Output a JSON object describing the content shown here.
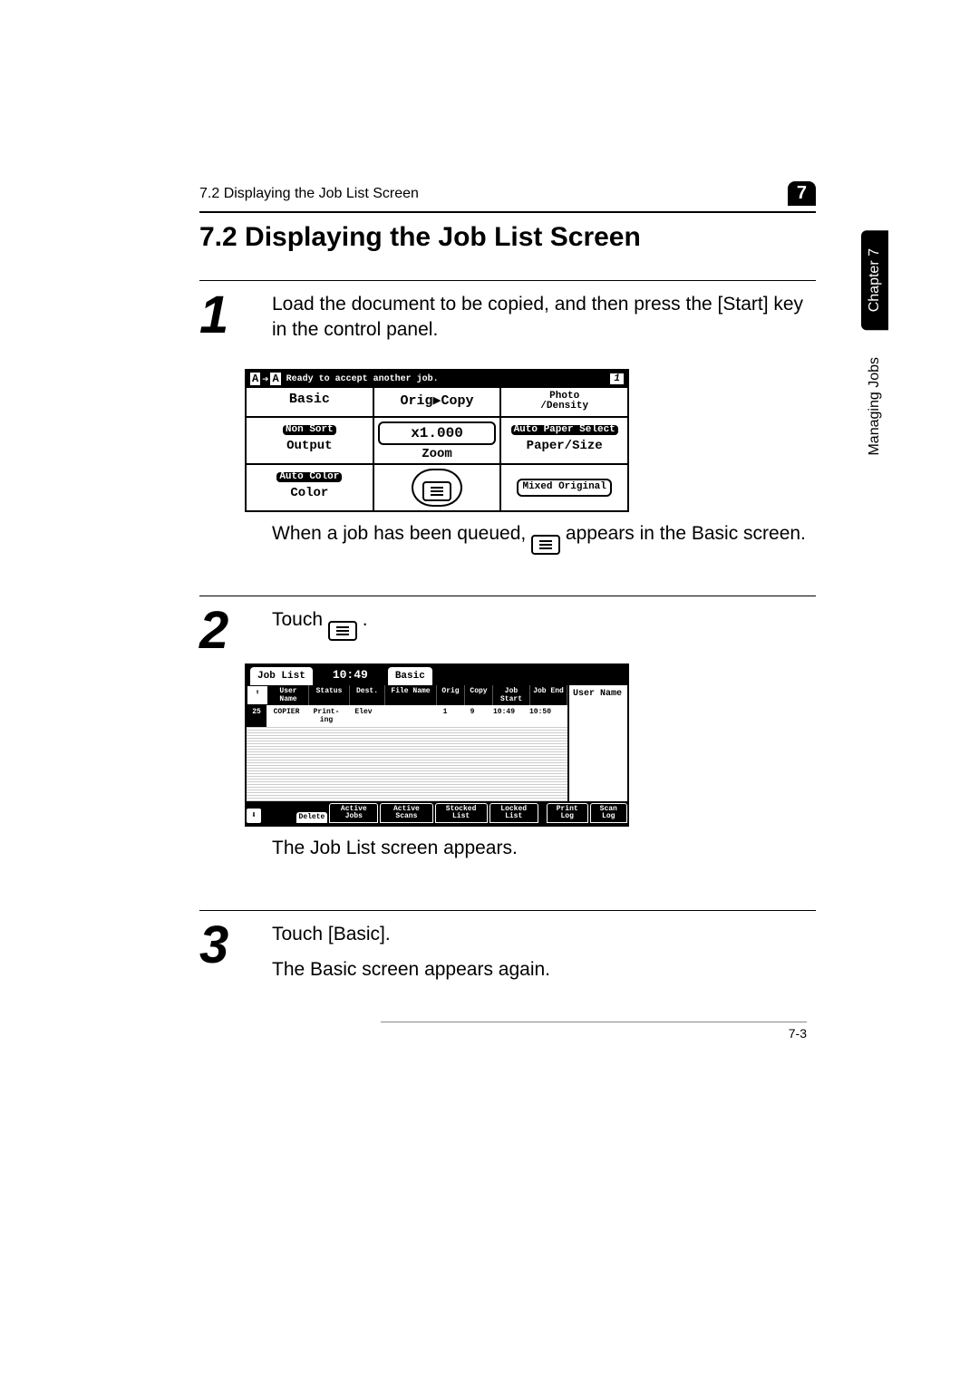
{
  "running_head": "7.2 Displaying the Job List Screen",
  "corner_tab": "7",
  "section_title": "7.2   Displaying the Job List Screen",
  "side": {
    "chapter": "Chapter 7",
    "section": "Managing Jobs"
  },
  "step1": {
    "num": "1",
    "text": "Load the document to be copied, and then press the [Start] key in the control panel.",
    "after1": "When a job has been queued, ",
    "after2": " appears in the Basic screen."
  },
  "screen1": {
    "status_msg": "Ready to accept another job.",
    "slot": "1",
    "tabs": {
      "basic": "Basic",
      "orig": "Orig▶Copy",
      "photo_l1": "Photo",
      "photo_l2": "/Density"
    },
    "row1": {
      "nonsort": "Non Sort",
      "output": "Output",
      "zoom_val": "x1.000",
      "zoom": "Zoom",
      "autopaper": "Auto Paper Select",
      "papersize": "Paper/Size"
    },
    "row2": {
      "autocolor": "Auto Color",
      "color": "Color",
      "mixed": "Mixed Original"
    }
  },
  "step2": {
    "num": "2",
    "text_before": "Touch ",
    "text_after": " .",
    "result": "The Job List screen appears."
  },
  "screen2": {
    "tab_joblist": "Job List",
    "time": "10:49",
    "tab_basic": "Basic",
    "headers": [
      "User Name",
      "Status",
      "Dest.",
      "File Name",
      "Orig",
      "Copy",
      "Job Start",
      "Job End"
    ],
    "right_header": "User Name",
    "row": {
      "num": "25",
      "user": "COPIER",
      "status": "Print- ing",
      "dest": "Elev",
      "file": "",
      "orig": "1",
      "copy": "9",
      "start": "10:49",
      "end": "10:50"
    },
    "bottom": {
      "delete": "Delete",
      "active_jobs": "Active Jobs",
      "active_scans": "Active Scans",
      "stocked": "Stocked List",
      "locked": "Locked List",
      "print_log": "Print Log",
      "scan_log": "Scan Log"
    }
  },
  "step3": {
    "num": "3",
    "line1": "Touch [Basic].",
    "line2": "The Basic screen appears again."
  },
  "footer": "7-3"
}
